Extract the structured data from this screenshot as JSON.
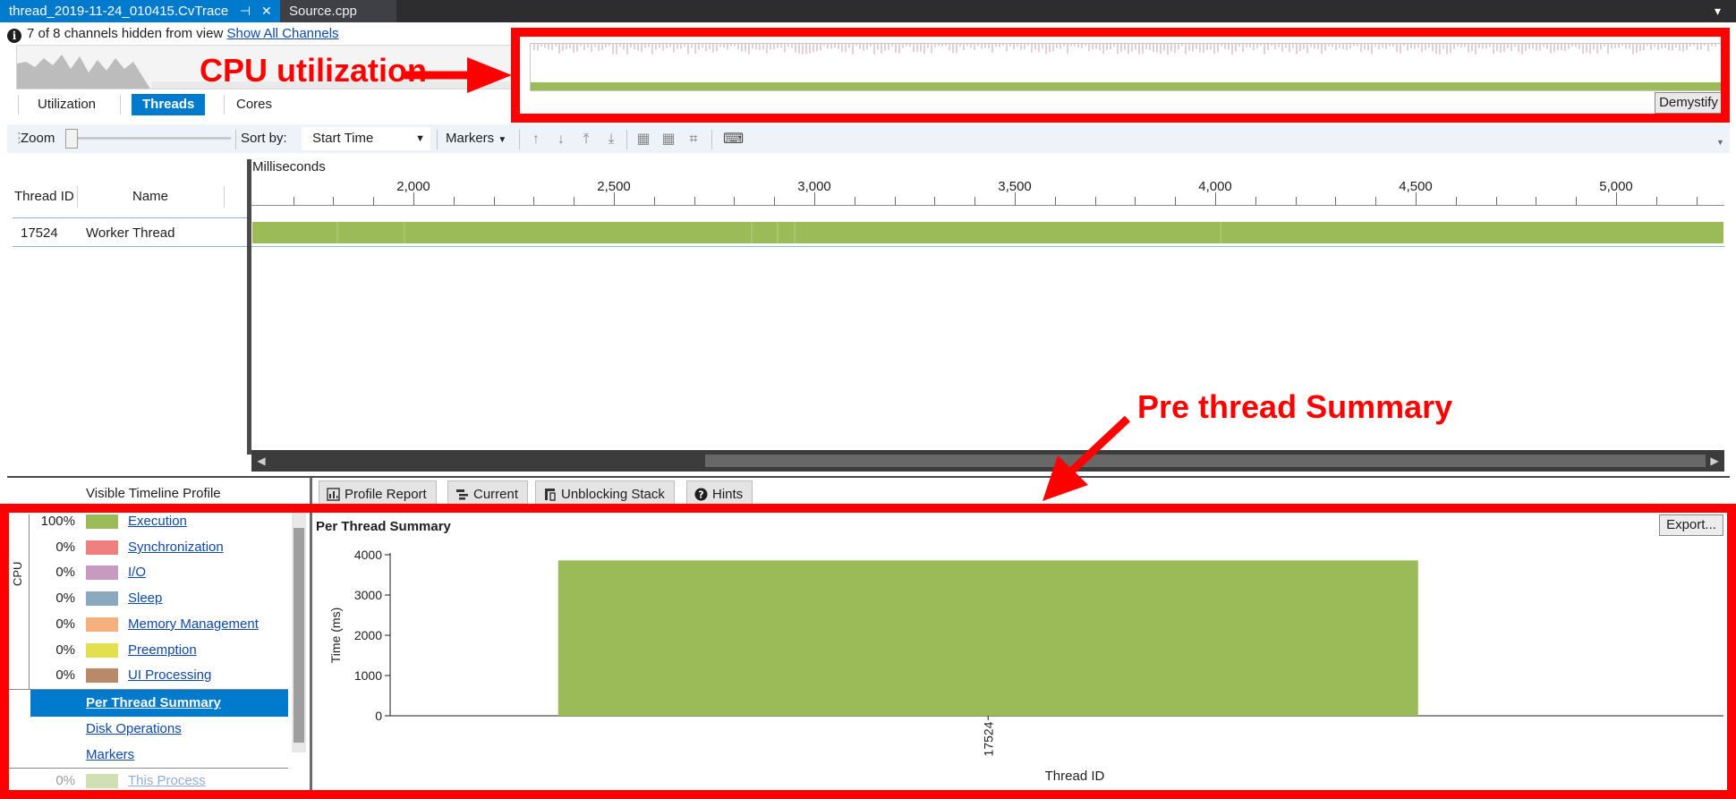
{
  "tabs": {
    "active_doc": "thread_2019-11-24_010415.CvTrace",
    "pin_glyph": "⊣",
    "close_glyph": "✕",
    "other_doc": "Source.cpp",
    "overflow_glyph": "▾"
  },
  "infobar": {
    "message": "7 of 8 channels hidden from view",
    "link": "Show All Channels"
  },
  "views": {
    "utilization": "Utilization",
    "threads": "Threads",
    "cores": "Cores",
    "demystify": "Demystify"
  },
  "toolbar": {
    "zoom_label": "Zoom",
    "sort_label": "Sort by:",
    "sort_value": "Start Time",
    "markers_label": "Markers"
  },
  "timeline": {
    "units_label": "Milliseconds",
    "columns": [
      "Thread ID",
      "Name"
    ],
    "rows": [
      {
        "id": "17524",
        "name": "Worker Thread"
      }
    ],
    "tick_labels": [
      "2,000",
      "2,500",
      "3,000",
      "3,500",
      "4,000",
      "4,500",
      "5,000"
    ]
  },
  "profile": {
    "title": "Visible Timeline Profile",
    "group_label": "CPU",
    "categories": [
      {
        "pct": "100%",
        "label": "Execution",
        "color": "#9bbb59"
      },
      {
        "pct": "0%",
        "label": "Synchronization",
        "color": "#f08080"
      },
      {
        "pct": "0%",
        "label": "I/O",
        "color": "#c89ac0"
      },
      {
        "pct": "0%",
        "label": "Sleep",
        "color": "#8aa9bf"
      },
      {
        "pct": "0%",
        "label": "Memory Management",
        "color": "#f6b07e"
      },
      {
        "pct": "0%",
        "label": "Preemption",
        "color": "#e2e04c"
      },
      {
        "pct": "0%",
        "label": "UI Processing",
        "color": "#b88a68"
      }
    ],
    "nav": [
      "Per Thread Summary",
      "Disk Operations",
      "Markers"
    ],
    "partial_row": {
      "pct": "0%",
      "label": "This Process"
    }
  },
  "report_tabs": [
    "Profile Report",
    "Current",
    "Unblocking Stack",
    "Hints"
  ],
  "report": {
    "title": "Per Thread Summary",
    "export_label": "Export..."
  },
  "chart_data": {
    "type": "bar",
    "categories": [
      "17524"
    ],
    "values": [
      3860
    ],
    "title": "Per Thread Summary",
    "xlabel": "Thread ID",
    "ylabel": "Time (ms)",
    "ylim": [
      0,
      4000
    ],
    "yticks": [
      0,
      1000,
      2000,
      3000,
      4000
    ],
    "bar_color": "#9bbb59",
    "grid": false
  },
  "annotations": {
    "cpu_label": "CPU utilization",
    "thread_summary_label": "Pre thread Summary",
    "color": "#ff0000"
  }
}
